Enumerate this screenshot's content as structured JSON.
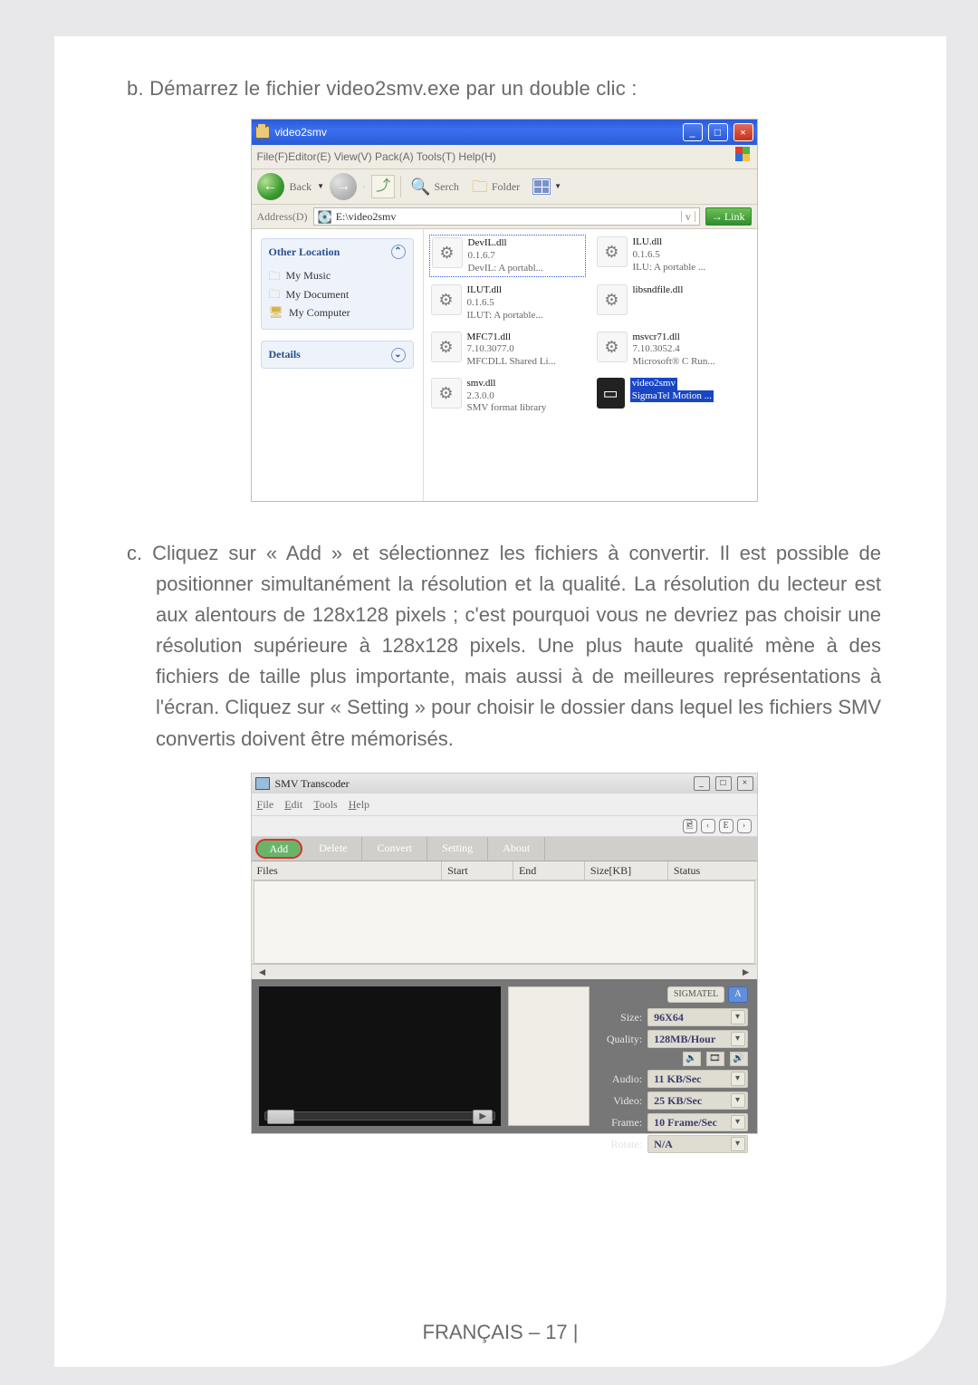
{
  "step_b": {
    "prefix": "b.",
    "text": "Démarrez le fichier video2smv.exe par un double clic :"
  },
  "explorer": {
    "title": "video2smv",
    "menubar": "File(F)Editor(E)  View(V)  Pack(A)  Tools(T)   Help(H)",
    "toolbar": {
      "back": "Back",
      "search": "Serch",
      "folder": "Folder"
    },
    "address": {
      "label": "Address(D)",
      "value": "E:\\video2smv",
      "link": "Link"
    },
    "side": {
      "otherLocation": {
        "title": "Other Location",
        "items": [
          "My Music",
          "My Document",
          "My Computer"
        ]
      },
      "details": {
        "title": "Details"
      }
    },
    "files": [
      {
        "name": "DevIL.dll",
        "v": "0.1.6.7",
        "d": "DevIL: A portabl..."
      },
      {
        "name": "ILU.dll",
        "v": "0.1.6.5",
        "d": "ILU: A portable ..."
      },
      {
        "name": "ILUT.dll",
        "v": "0.1.6.5",
        "d": "ILUT: A portable..."
      },
      {
        "name": "libsndfile.dll",
        "v": "",
        "d": ""
      },
      {
        "name": "MFC71.dll",
        "v": "7.10.3077.0",
        "d": "MFCDLL Shared Li..."
      },
      {
        "name": "msvcr71.dll",
        "v": "7.10.3052.4",
        "d": "Microsoft® C Run..."
      },
      {
        "name": "smv.dll",
        "v": "2.3.0.0",
        "d": "SMV format library"
      },
      {
        "name": "video2smv",
        "v": "",
        "d": "SigmaTel Motion ..."
      }
    ]
  },
  "step_c": {
    "prefix": "c.",
    "text": "Cliquez sur « Add » et sélectionnez les fichiers à convertir. Il est possible de positionner simultanément la résolution et la qualité. La résolution du lecteur est aux alentours de 128x128 pixels ; c'est pourquoi vous ne devriez pas choisir une résolution supérieure à 128x128 pixels. Une plus haute qualité mène à des fichiers de taille plus importante, mais aussi à de meilleures représentations à l'écran. Cliquez sur « Setting » pour choisir le dossier dans lequel les fichiers SMV convertis doivent être mémorisés."
  },
  "smv": {
    "title": "SMV Transcoder",
    "menu": {
      "file": "File",
      "edit": "Edit",
      "tools": "Tools",
      "help": "Help"
    },
    "tabs": {
      "add": "Add",
      "delete": "Delete",
      "convert": "Convert",
      "setting": "Setting",
      "about": "About"
    },
    "cols": {
      "files": "Files",
      "start": "Start",
      "end": "End",
      "size": "Size[KB]",
      "status": "Status"
    },
    "opts": {
      "size": {
        "label": "Size:",
        "value": "96X64"
      },
      "quality": {
        "label": "Quality:",
        "value": "128MB/Hour"
      },
      "audio": {
        "label": "Audio:",
        "value": "11 KB/Sec"
      },
      "video": {
        "label": "Video:",
        "value": "25 KB/Sec"
      },
      "frame": {
        "label": "Frame:",
        "value": "10 Frame/Sec"
      },
      "rotate": {
        "label": "Rotate:",
        "value": "N/A"
      }
    }
  },
  "footer": "FRANÇAIS – 17  |"
}
